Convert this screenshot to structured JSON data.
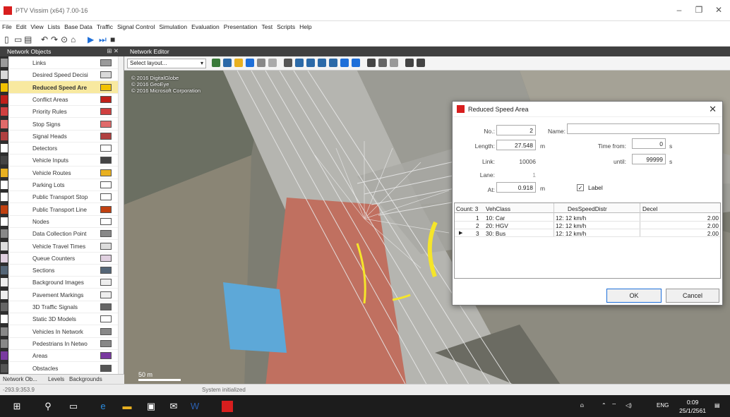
{
  "window": {
    "title": "PTV Vissim (x64) 7.00-16"
  },
  "menu": [
    "File",
    "Edit",
    "View",
    "Lists",
    "Base Data",
    "Traffic",
    "Signal Control",
    "Simulation",
    "Evaluation",
    "Presentation",
    "Test",
    "Scripts",
    "Help"
  ],
  "left_panel": {
    "title": "Network Objects",
    "items": [
      {
        "label": "Links",
        "color": "#9a9a9a"
      },
      {
        "label": "Desired Speed Decisi",
        "color": "#d9d9d9"
      },
      {
        "label": "Reduced Speed Are",
        "color": "#f2c200",
        "selected": true
      },
      {
        "label": "Conflict Areas",
        "color": "#c0201a"
      },
      {
        "label": "Priority Rules",
        "color": "#d04040"
      },
      {
        "label": "Stop Signs",
        "color": "#e06a6a"
      },
      {
        "label": "Signal Heads",
        "color": "#b04040"
      },
      {
        "label": "Detectors",
        "color": "#ffffff"
      },
      {
        "label": "Vehicle Inputs",
        "color": "#444444"
      },
      {
        "label": "Vehicle Routes",
        "color": "#e8b020"
      },
      {
        "label": "Parking Lots",
        "color": "#ffffff"
      },
      {
        "label": "Public Transport Stop",
        "color": "#ffffff"
      },
      {
        "label": "Public Transport Line",
        "color": "#c04010"
      },
      {
        "label": "Nodes",
        "color": "#ffffff"
      },
      {
        "label": "Data Collection Point",
        "color": "#888888"
      },
      {
        "label": "Vehicle Travel Times",
        "color": "#dddddd"
      },
      {
        "label": "Queue Counters",
        "color": "#e0d0e0"
      },
      {
        "label": "Sections",
        "color": "#556677"
      },
      {
        "label": "Background Images",
        "color": "#eeeeee"
      },
      {
        "label": "Pavement Markings",
        "color": "#eeeeee"
      },
      {
        "label": "3D Traffic Signals",
        "color": "#666666"
      },
      {
        "label": "Static 3D Models",
        "color": "#ffffff"
      },
      {
        "label": "Vehicles In Network",
        "color": "#888888"
      },
      {
        "label": "Pedestrians In Netwo",
        "color": "#888888"
      },
      {
        "label": "Areas",
        "color": "#7a3aa0"
      },
      {
        "label": "Obstacles",
        "color": "#555555"
      }
    ],
    "tabs": [
      "Network Ob...",
      "Levels",
      "Backgrounds"
    ]
  },
  "editor": {
    "title": "Network Editor",
    "layout_placeholder": "Select layout...",
    "copyright": [
      "© 2016 DigitalGlobe",
      "© 2016 GeoEye",
      "© 2016 Microsoft Corporation"
    ],
    "scale_label": "50 m"
  },
  "dialog": {
    "title": "Reduced Speed Area",
    "no_label": "No.:",
    "no_value": "2",
    "name_label": "Name:",
    "name_value": "",
    "length_label": "Length:",
    "length_value": "27.548",
    "length_unit": "m",
    "link_label": "Link:",
    "link_value": "10006",
    "lane_label": "Lane:",
    "lane_value": "1",
    "at_label": "At:",
    "at_value": "0.918",
    "at_unit": "m",
    "time_from_label": "Time from:",
    "time_from_value": "0",
    "time_from_unit": "s",
    "until_label": "until:",
    "until_value": "99999",
    "until_unit": "s",
    "label_checkbox": "Label",
    "grid": {
      "count_label": "Count: 3",
      "columns": [
        "VehClass",
        "DesSpeedDistr",
        "Decel"
      ],
      "rows": [
        {
          "no": "1",
          "vehclass": "10: Car",
          "speed": "12: 12 km/h",
          "decel": "2.00"
        },
        {
          "no": "2",
          "vehclass": "20: HGV",
          "speed": "12: 12 km/h",
          "decel": "2.00"
        },
        {
          "no": "3",
          "vehclass": "30: Bus",
          "speed": "12: 12 km/h",
          "decel": "2.00"
        }
      ]
    },
    "ok_label": "OK",
    "cancel_label": "Cancel"
  },
  "status": {
    "coords": "-293.9:353.9",
    "message": "System initialized"
  },
  "taskbar": {
    "lang": "ENG",
    "time": "0:09",
    "date": "25/1/2561"
  }
}
